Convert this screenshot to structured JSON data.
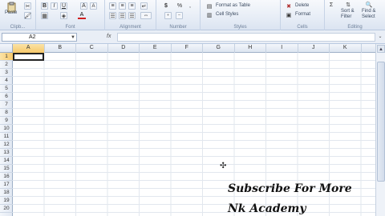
{
  "ribbon": {
    "clipboard": {
      "paste_label": "Paste",
      "group_label": "Clipb..."
    },
    "font": {
      "group_label": "Font",
      "bold": "B",
      "italic": "I",
      "underline": "U",
      "font_color_glyph": "A"
    },
    "alignment": {
      "group_label": "Alignment"
    },
    "number": {
      "group_label": "Number",
      "currency": "$",
      "percent": "%"
    },
    "styles": {
      "format_table_label": "Format as Table",
      "cell_styles_label": "Cell Styles",
      "group_label": "Styles"
    },
    "cells": {
      "delete_label": "Delete",
      "format_label": "Format",
      "group_label": "Cells"
    },
    "editing": {
      "sort_label": "Sort &",
      "filter_label": "Filter",
      "find_label": "Find &",
      "select_label": "Select",
      "group_label": "Editing"
    }
  },
  "formula_bar": {
    "name_box": "A2",
    "fx_label": "fx",
    "value": ""
  },
  "columns": [
    "A",
    "B",
    "C",
    "D",
    "E",
    "F",
    "G",
    "H",
    "I",
    "J",
    "K"
  ],
  "rows": [
    "1",
    "2",
    "3",
    "4",
    "5",
    "6",
    "7",
    "8",
    "9",
    "10",
    "11",
    "12",
    "13",
    "14",
    "15",
    "16",
    "17",
    "18",
    "19",
    "20"
  ],
  "active_column": "A",
  "active_row": "1",
  "overlay": {
    "line1": "Subscribe For More",
    "line2": "Nk Academy"
  }
}
